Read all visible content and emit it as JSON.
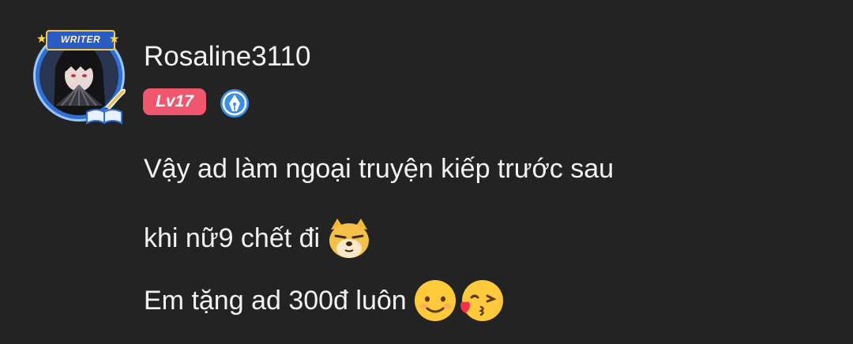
{
  "comment": {
    "avatar": {
      "frame_label": "WRITER",
      "icon": "writer-avatar-frame"
    },
    "username": "Rosaline3110",
    "level": "Lv17",
    "writer_badge_icon": "pen-nib-icon",
    "body_lines": [
      "Vậy ad làm ngoại truyện kiếp trước sau",
      "khi nữ9 chết đi",
      "Em tặng ad 300đ luôn"
    ],
    "emojis": {
      "line2": [
        "smug-doge-emoji"
      ],
      "line3": [
        "smiling-face-emoji",
        "kissing-face-emoji"
      ]
    },
    "colors": {
      "background": "#232323",
      "level_badge": "#f0576f",
      "writer_badge": "#3a8ee6"
    }
  }
}
